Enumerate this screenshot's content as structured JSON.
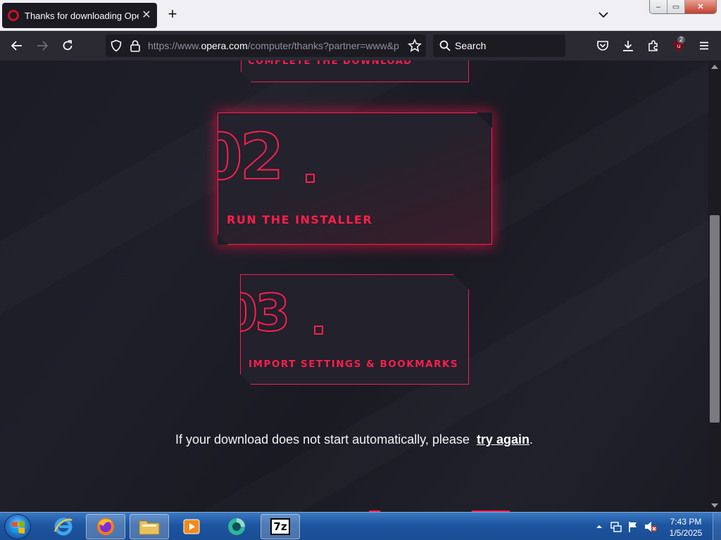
{
  "browser": {
    "tab_title": "Thanks for downloading Opera",
    "tab_close_glyph": "✕",
    "new_tab_glyph": "+",
    "url_prefix": "https://www.",
    "url_domain": "opera.com",
    "url_path": "/computer/thanks?partner=www&p",
    "search_placeholder": "Search",
    "extension_badge_count": "2",
    "window_controls": {
      "minimize": "–",
      "maximize": "▭",
      "close": "✕"
    }
  },
  "page": {
    "step1_label": "COMPLETE THE DOWNLOAD",
    "step2_number": "02",
    "step2_label": "RUN THE INSTALLER",
    "step3_number": "03",
    "step3_label": "IMPORT SETTINGS & BOOKMARKS",
    "retry_message": "If your download does not start automatically, please",
    "retry_link": "try again",
    "retry_period": "."
  },
  "taskbar": {
    "pinned": [
      "internet-explorer",
      "firefox",
      "file-explorer",
      "media-player",
      "screen-app",
      "7zip"
    ],
    "sevenzip_label": "7z",
    "clock_time": "7:43 PM",
    "clock_date": "1/5/2025"
  },
  "colors": {
    "accent": "#ff1e4c",
    "page_bg": "#1a1a23",
    "toolbar_bg": "#2b2a33"
  }
}
